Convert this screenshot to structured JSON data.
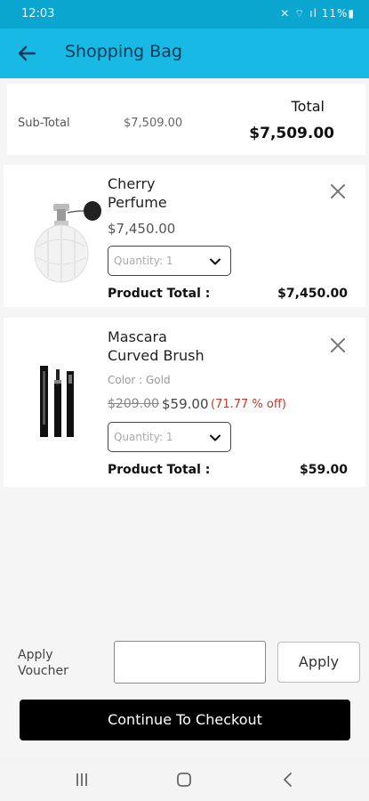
{
  "status_bar": {
    "time": "12:03",
    "system": "✕ ⌔ ıl 11%▮"
  },
  "app_bar": {
    "title": "Shopping Bag"
  },
  "summary": {
    "subtotal_label": "Sub-Total",
    "subtotal_value": "$7,509.00",
    "total_label": "Total",
    "total_value": "$7,509.00"
  },
  "items": [
    {
      "name_line1": "Cherry",
      "name_line2": "Perfume",
      "price": "$7,450.00",
      "quantity_text": "Quantity: 1",
      "product_total_label": "Product Total :",
      "product_total_value": "$7,450.00"
    },
    {
      "name_line1": "Mascara",
      "name_line2": "Curved Brush",
      "color": "Color : Gold",
      "old_price": "$209.00",
      "price": "$59.00",
      "discount": "(71.77 % off)",
      "quantity_text": "Quantity: 1",
      "product_total_label": "Product Total :",
      "product_total_value": "$59.00"
    }
  ],
  "voucher": {
    "label_line1": "Apply",
    "label_line2": "Voucher",
    "input_value": "",
    "apply_label": "Apply"
  },
  "checkout_label": "Continue To Checkout",
  "icons": {
    "back": "arrow-left-icon",
    "remove": "close-icon",
    "dropdown": "chevron-down-icon",
    "nav_recents": "recents-icon",
    "nav_home": "home-icon",
    "nav_back": "nav-back-icon"
  },
  "colors": {
    "status_bar": "#0aa6cf",
    "app_bar": "#19b9e6",
    "discount": "#c0392b",
    "checkout_bg": "#000000"
  }
}
